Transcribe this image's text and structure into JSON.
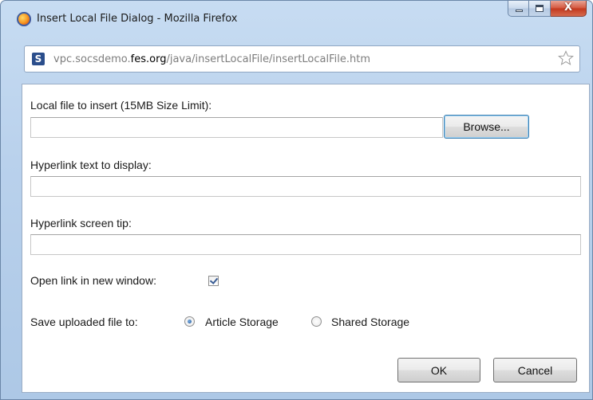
{
  "window": {
    "title": "Insert Local File Dialog - Mozilla Firefox",
    "close_glyph": "X"
  },
  "addressbar": {
    "url_prefix": "vpc.socsdemo.",
    "url_host": "fes.org",
    "url_path": "/java/insertLocalFile/insertLocalFile.htm",
    "site_icon_letter": "S"
  },
  "form": {
    "file_label": "Local file to insert (15MB Size Limit):",
    "file_value": "",
    "browse_label": "Browse...",
    "hyperlink_text_label": "Hyperlink text to display:",
    "hyperlink_text_value": "",
    "screen_tip_label": "Hyperlink screen tip:",
    "screen_tip_value": "",
    "new_window_label": "Open link in new window:",
    "new_window_checked": true,
    "save_to_label": "Save uploaded file to:",
    "storage_options": [
      {
        "label": "Article Storage",
        "checked": true
      },
      {
        "label": "Shared Storage",
        "checked": false
      }
    ],
    "ok_label": "OK",
    "cancel_label": "Cancel"
  },
  "icons": {
    "app": "firefox-icon",
    "site": "site-favicon-icon",
    "bookmark": "star-icon"
  }
}
